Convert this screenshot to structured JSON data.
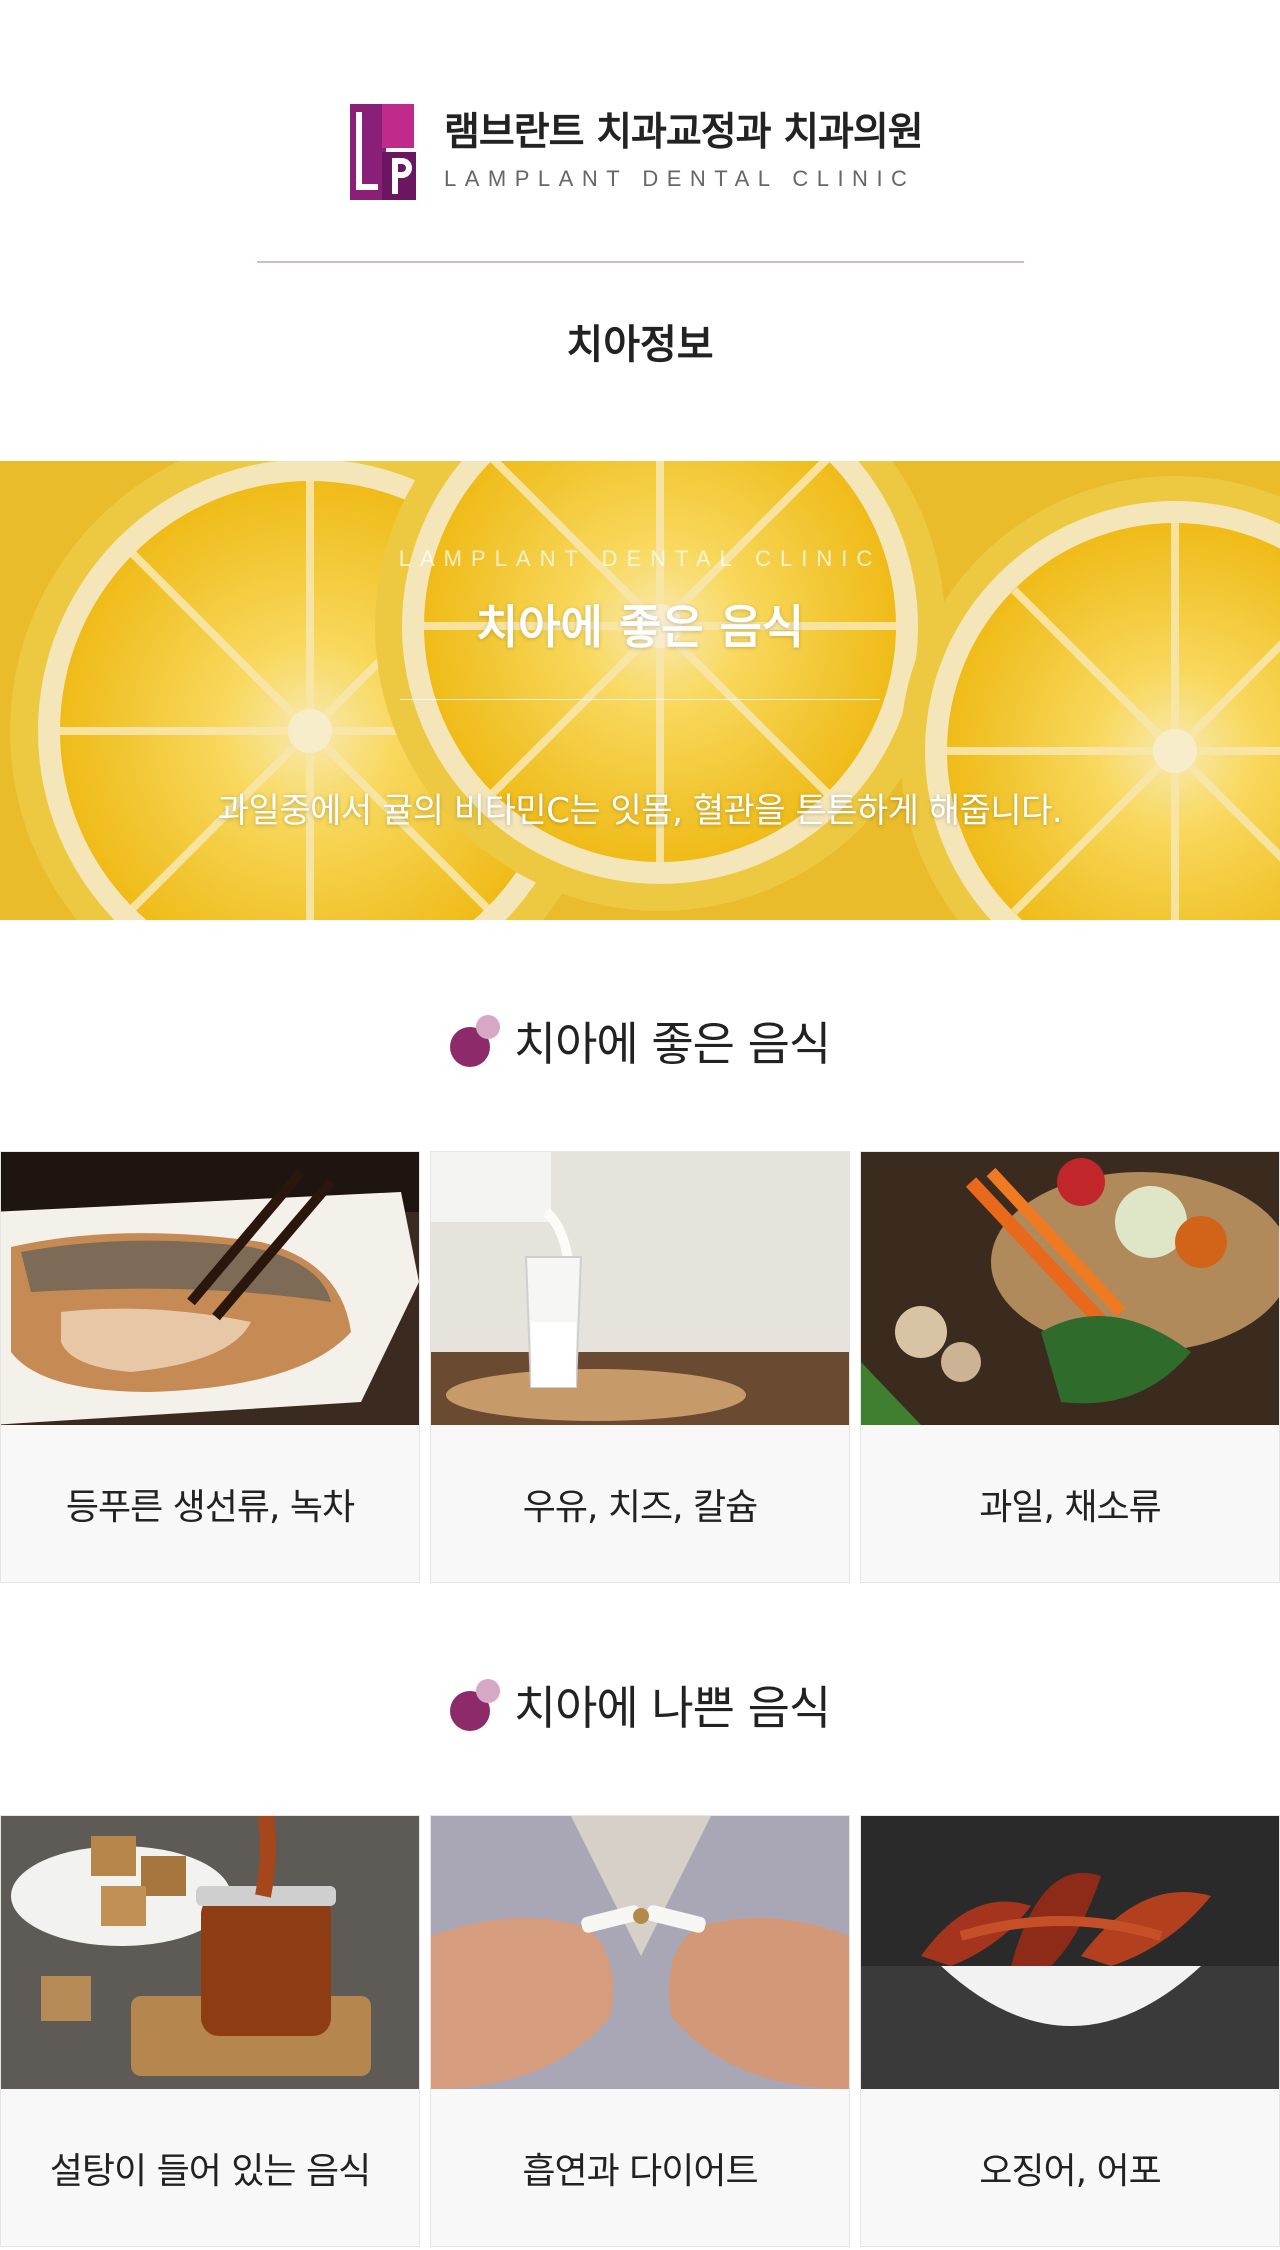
{
  "header": {
    "clinic_name_kr": "램브란트 치과교정과 치과의원",
    "clinic_name_en": "LAMPLANT DENTAL CLINIC",
    "page_title": "치아정보"
  },
  "hero": {
    "subtitle": "LAMPLANT DENTAL CLINIC",
    "title": "치아에 좋은 음식",
    "description": "과일중에서 귤의 비타민C는 잇몸, 혈관을 튼튼하게 해줍니다."
  },
  "good_foods": {
    "heading": "치아에 좋은 음식",
    "items": [
      {
        "label": "등푸른 생선류, 녹차",
        "image": "grilled-fish-photo"
      },
      {
        "label": "우유, 치즈, 칼슘",
        "image": "milk-glass-photo"
      },
      {
        "label": "과일, 채소류",
        "image": "vegetables-basket-photo"
      }
    ]
  },
  "bad_foods": {
    "heading": "치아에 나쁜 음식",
    "items": [
      {
        "label": "설탕이 들어 있는 음식",
        "image": "caramel-jar-photo"
      },
      {
        "label": "흡연과 다이어트",
        "image": "broken-cigarette-photo"
      },
      {
        "label": "오징어, 어포",
        "image": "dried-squid-photo"
      }
    ]
  },
  "colors": {
    "brand_purple": "#8c2a6a",
    "brand_pink": "#d7a8c6",
    "divider": "#d8b9c9",
    "hero_yellow": "#f2c52c"
  }
}
